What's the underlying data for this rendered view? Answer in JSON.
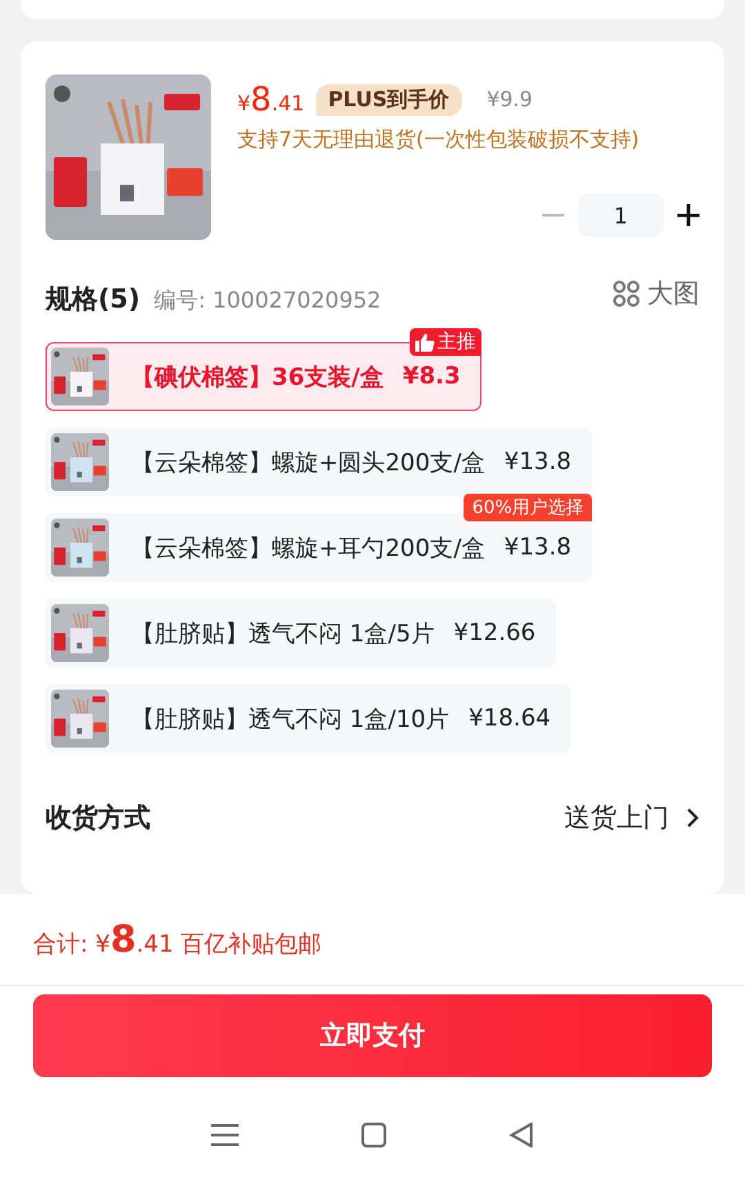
{
  "product": {
    "currency": "¥",
    "price_int": "8",
    "price_dec": ".41",
    "plus_label": "PLUS到手价",
    "original_price": "¥9.9",
    "return_policy": "支持7天无理由退货(一次性包装破损不支持)",
    "quantity": "1",
    "minus_disabled": true
  },
  "spec": {
    "title": "规格(5)",
    "sku": "编号: 100027020952",
    "big_image": "大图"
  },
  "options": [
    {
      "title": "【碘伏棉签】36支装/盒",
      "price": "¥8.3",
      "selected": true,
      "badge": {
        "kind": "recommend",
        "text": "主推"
      }
    },
    {
      "title": "【云朵棉签】螺旋+圆头200支/盒",
      "price": "¥13.8",
      "selected": false
    },
    {
      "title": "【云朵棉签】螺旋+耳勺200支/盒",
      "price": "¥13.8",
      "selected": false,
      "badge": {
        "kind": "popular",
        "text": "60%用户选择"
      }
    },
    {
      "title": "【肚脐贴】透气不闷 1盒/5片",
      "price": "¥12.66",
      "selected": false
    },
    {
      "title": "【肚脐贴】透气不闷 1盒/10片",
      "price": "¥18.64",
      "selected": false
    }
  ],
  "delivery": {
    "label": "收货方式",
    "value": "送货上门"
  },
  "footer": {
    "total_label": "合计:",
    "currency": "¥",
    "total_int": "8",
    "total_dec": ".41",
    "note": "百亿补贴包邮",
    "pay_button": "立即支付"
  }
}
